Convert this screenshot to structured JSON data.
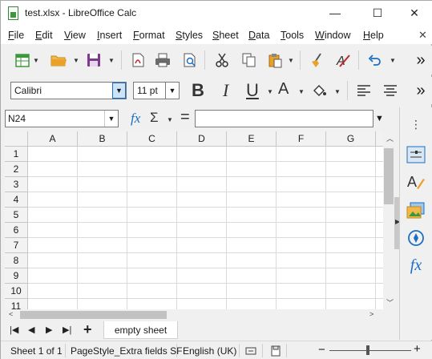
{
  "window": {
    "title": "test.xlsx - LibreOffice Calc",
    "minimize": "—",
    "maximize": "☐",
    "close": "✕"
  },
  "menubar": {
    "items": [
      {
        "label": "File",
        "key": "F",
        "rest": "ile"
      },
      {
        "label": "Edit",
        "key": "E",
        "rest": "dit"
      },
      {
        "label": "View",
        "key": "V",
        "rest": "iew"
      },
      {
        "label": "Insert",
        "key": "I",
        "rest": "nsert"
      },
      {
        "label": "Format",
        "key": "F",
        "rest": "ormat"
      },
      {
        "label": "Styles",
        "key": "S",
        "rest": "tyles"
      },
      {
        "label": "Sheet",
        "key": "S",
        "rest": "heet"
      },
      {
        "label": "Data",
        "key": "D",
        "rest": "ata"
      },
      {
        "label": "Tools",
        "key": "T",
        "rest": "ools"
      },
      {
        "label": "Window",
        "key": "W",
        "rest": "indow"
      },
      {
        "label": "Help",
        "key": "H",
        "rest": "elp"
      }
    ],
    "close_doc": "✕"
  },
  "toolbar": {
    "font_name": "Calibri",
    "font_size": "11 pt",
    "bold": "B",
    "italic": "I",
    "underline": "U",
    "font_color_letter": "A",
    "more": "»"
  },
  "formula": {
    "name_box": "N24",
    "fx": "fx",
    "sigma": "Σ",
    "equals": "=",
    "value": ""
  },
  "grid": {
    "columns": [
      "A",
      "B",
      "C",
      "D",
      "E",
      "F",
      "G"
    ],
    "rows": [
      "1",
      "2",
      "3",
      "4",
      "5",
      "6",
      "7",
      "8",
      "9",
      "10",
      "11"
    ]
  },
  "sheets": {
    "add": "+",
    "tabs": [
      "empty sheet"
    ]
  },
  "status": {
    "sheet_position": "Sheet 1 of 1",
    "page_style": "PageStyle_Extra fields SF",
    "language": "English (UK)",
    "zoom_minus": "−",
    "zoom_plus": "+"
  },
  "colors": {
    "accent": "#1a6fc4",
    "calc_green": "#3a9a3a",
    "folder_orange": "#e8a22a",
    "save_purple": "#7d3b8c"
  }
}
